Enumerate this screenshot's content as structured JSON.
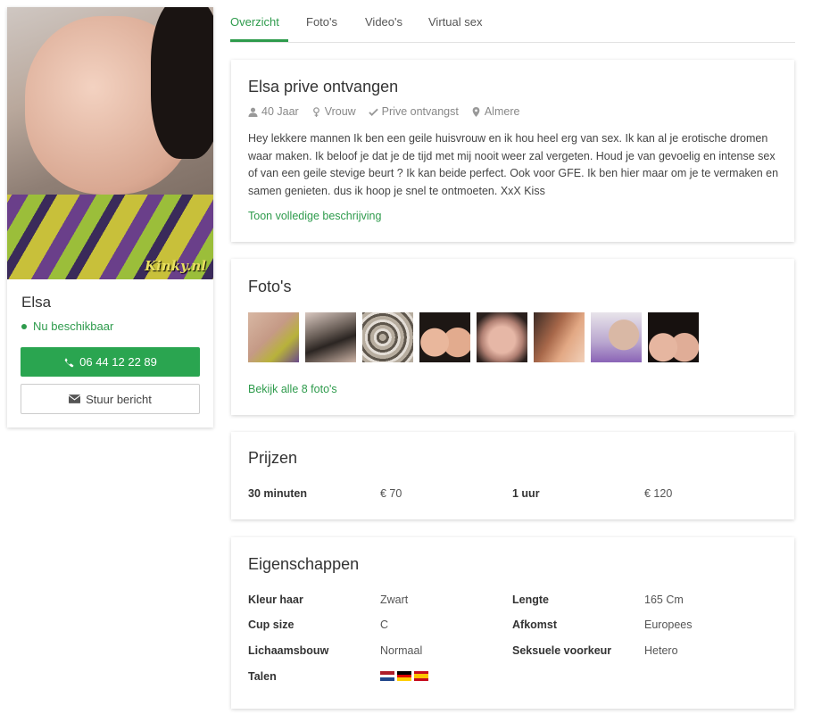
{
  "profile": {
    "name": "Elsa",
    "watermark": "Kinky.nl",
    "status": "Nu beschikbaar",
    "phone_label": "06 44 12 22 89",
    "message_label": "Stuur bericht"
  },
  "tabs": [
    {
      "label": "Overzicht",
      "active": true
    },
    {
      "label": "Foto's",
      "active": false
    },
    {
      "label": "Video's",
      "active": false
    },
    {
      "label": "Virtual sex",
      "active": false
    }
  ],
  "overview": {
    "title": "Elsa prive ontvangen",
    "age": "40 Jaar",
    "gender": "Vrouw",
    "reception": "Prive ontvangst",
    "city": "Almere",
    "description": "Hey lekkere mannen Ik ben een geile huisvrouw en ik hou heel erg van sex. Ik kan al je erotische dromen waar maken. Ik beloof je dat je de tijd met mij nooit weer zal vergeten. Houd je van gevoelig en intense sex of van een geile stevige beurt ? Ik kan beide perfect. Ook voor GFE. Ik ben hier maar om je te vermaken en samen genieten. dus ik hoop je snel te ontmoeten. XxX Kiss",
    "more_link": "Toon volledige beschrijving"
  },
  "photos": {
    "title": "Foto's",
    "thumbnail_count": 8,
    "all_link": "Bekijk alle 8 foto's"
  },
  "prices": {
    "title": "Prijzen",
    "rows": [
      {
        "label1": "30 minuten",
        "value1": "€ 70",
        "label2": "1 uur",
        "value2": "€ 120"
      }
    ]
  },
  "properties": {
    "title": "Eigenschappen",
    "rows": [
      {
        "label1": "Kleur haar",
        "value1": "Zwart",
        "label2": "Lengte",
        "value2": "165 Cm"
      },
      {
        "label1": "Cup size",
        "value1": "C",
        "label2": "Afkomst",
        "value2": "Europees"
      },
      {
        "label1": "Lichaamsbouw",
        "value1": "Normaal",
        "label2": "Seksuele voorkeur",
        "value2": "Hetero"
      }
    ],
    "languages_label": "Talen",
    "languages": [
      "nl-flag",
      "de-flag",
      "es-flag"
    ]
  },
  "colors": {
    "accent": "#2e9b4c",
    "phone_button": "#2aa550"
  }
}
